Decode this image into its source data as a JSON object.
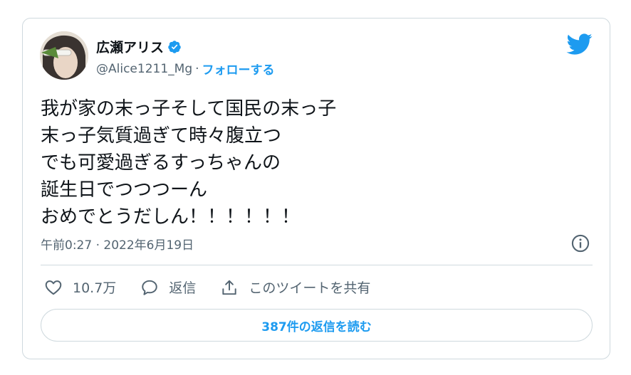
{
  "author": {
    "display_name": "広瀬アリス",
    "handle": "@Alice1211_Mg",
    "separator": "·",
    "follow_label": "フォローする"
  },
  "tweet": {
    "lines": [
      "我が家の末っ子そして国民の末っ子",
      "末っ子気質過ぎて時々腹立つ",
      "でも可愛過ぎるすっちゃんの",
      "誕生日でつつつーん",
      "おめでとうだしん！！！！！！"
    ],
    "time": "午前0:27 · 2022年6月19日"
  },
  "actions": {
    "like_count": "10.7万",
    "reply_label": "返信",
    "share_label": "このツイートを共有"
  },
  "read_replies_label": "387件の返信を読む",
  "colors": {
    "accent": "#1d9bf0",
    "text": "#0f1419",
    "muted": "#536471",
    "border": "#cfd9de"
  }
}
